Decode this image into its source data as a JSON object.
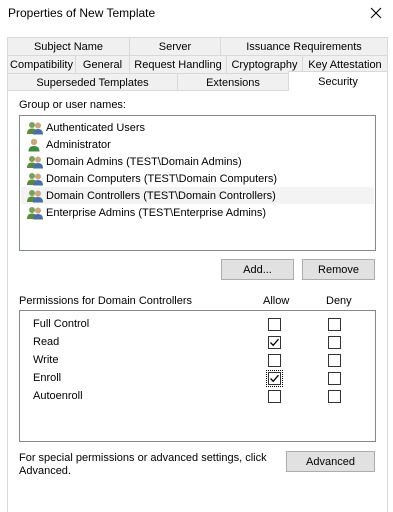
{
  "window": {
    "title": "Properties of New Template"
  },
  "tabs_row1": [
    "Subject Name",
    "Server",
    "Issuance Requirements"
  ],
  "tabs_row2": [
    "Compatibility",
    "General",
    "Request Handling",
    "Cryptography",
    "Key Attestation"
  ],
  "tabs_row3": [
    "Superseded Templates",
    "Extensions",
    "Security"
  ],
  "active_tab": "Security",
  "groups": {
    "label": "Group or user names:",
    "items": [
      {
        "name": "Authenticated Users",
        "icon": "user-group-icon",
        "selected": false
      },
      {
        "name": "Administrator",
        "icon": "user-icon",
        "selected": false
      },
      {
        "name": "Domain Admins (TEST\\Domain Admins)",
        "icon": "user-group-icon",
        "selected": false
      },
      {
        "name": "Domain Computers (TEST\\Domain Computers)",
        "icon": "user-group-icon",
        "selected": false
      },
      {
        "name": "Domain Controllers (TEST\\Domain Controllers)",
        "icon": "user-group-icon",
        "selected": true
      },
      {
        "name": "Enterprise Admins (TEST\\Enterprise Admins)",
        "icon": "user-group-icon",
        "selected": false
      }
    ]
  },
  "buttons": {
    "add": "Add...",
    "remove": "Remove",
    "advanced": "Advanced"
  },
  "permissions": {
    "label": "Permissions for Domain Controllers",
    "allow_header": "Allow",
    "deny_header": "Deny",
    "rows": [
      {
        "name": "Full Control",
        "allow": false,
        "deny": false
      },
      {
        "name": "Read",
        "allow": true,
        "deny": false
      },
      {
        "name": "Write",
        "allow": false,
        "deny": false
      },
      {
        "name": "Enroll",
        "allow": true,
        "deny": false
      },
      {
        "name": "Autoenroll",
        "allow": false,
        "deny": false
      }
    ]
  },
  "advanced_note": {
    "line1": "For special permissions or advanced settings, click",
    "line2": "Advanced."
  },
  "colors": {
    "tab_bg": "#f0f0f0",
    "border": "#d9d9d9",
    "button_bg": "#e1e1e1",
    "selection": "#f3f3f3"
  }
}
